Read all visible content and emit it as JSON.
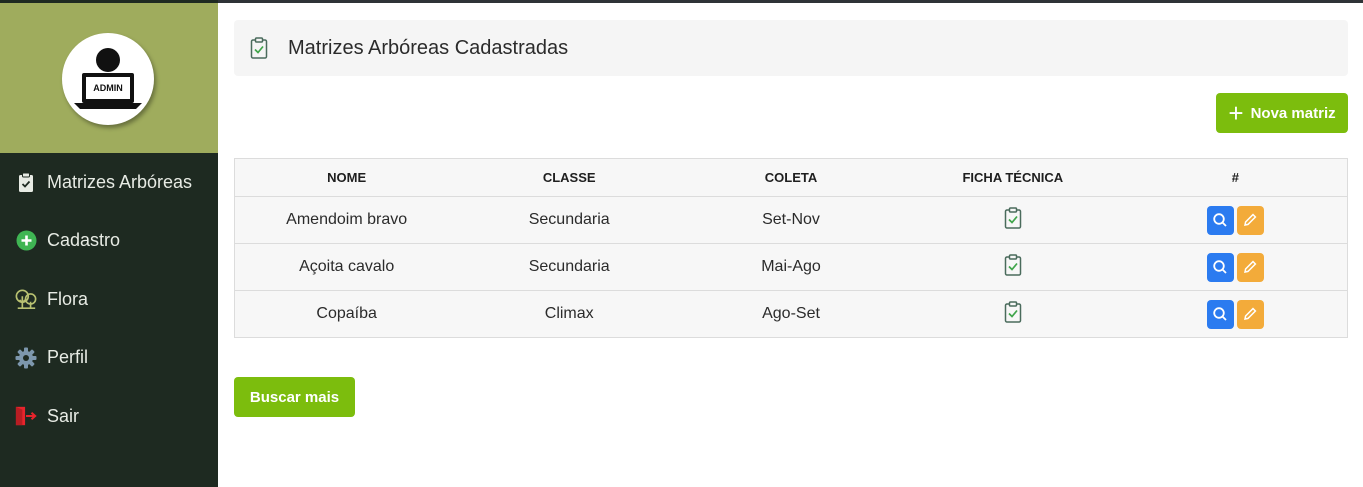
{
  "sidebar": {
    "avatar_badge": "ADMIN",
    "items": [
      {
        "label": "Matrizes Arbóreas",
        "icon": "clipboard-check-icon"
      },
      {
        "label": "Cadastro",
        "icon": "plus-circle-icon"
      },
      {
        "label": "Flora",
        "icon": "trees-icon"
      },
      {
        "label": "Perfil",
        "icon": "gear-icon"
      },
      {
        "label": "Sair",
        "icon": "exit-door-icon"
      }
    ]
  },
  "header": {
    "title": "Matrizes Arbóreas Cadastradas",
    "icon": "clipboard-check-icon"
  },
  "toolbar": {
    "new_label": "Nova matriz",
    "more_label": "Buscar mais"
  },
  "table": {
    "headers": [
      "NOME",
      "CLASSE",
      "COLETA",
      "FICHA TÉCNICA",
      "#"
    ],
    "rows": [
      {
        "nome": "Amendoim bravo",
        "classe": "Secundaria",
        "coleta": "Set-Nov"
      },
      {
        "nome": "Açoita cavalo",
        "classe": "Secundaria",
        "coleta": "Mai-Ago"
      },
      {
        "nome": "Copaíba",
        "classe": "Climax",
        "coleta": "Ago-Set"
      }
    ]
  },
  "colors": {
    "sidebar_bg": "#1e2a21",
    "profile_bg": "#9fac5d",
    "accent_green": "#7cbd0d",
    "view_blue": "#2b7bf0",
    "edit_orange": "#f3ab3a"
  }
}
